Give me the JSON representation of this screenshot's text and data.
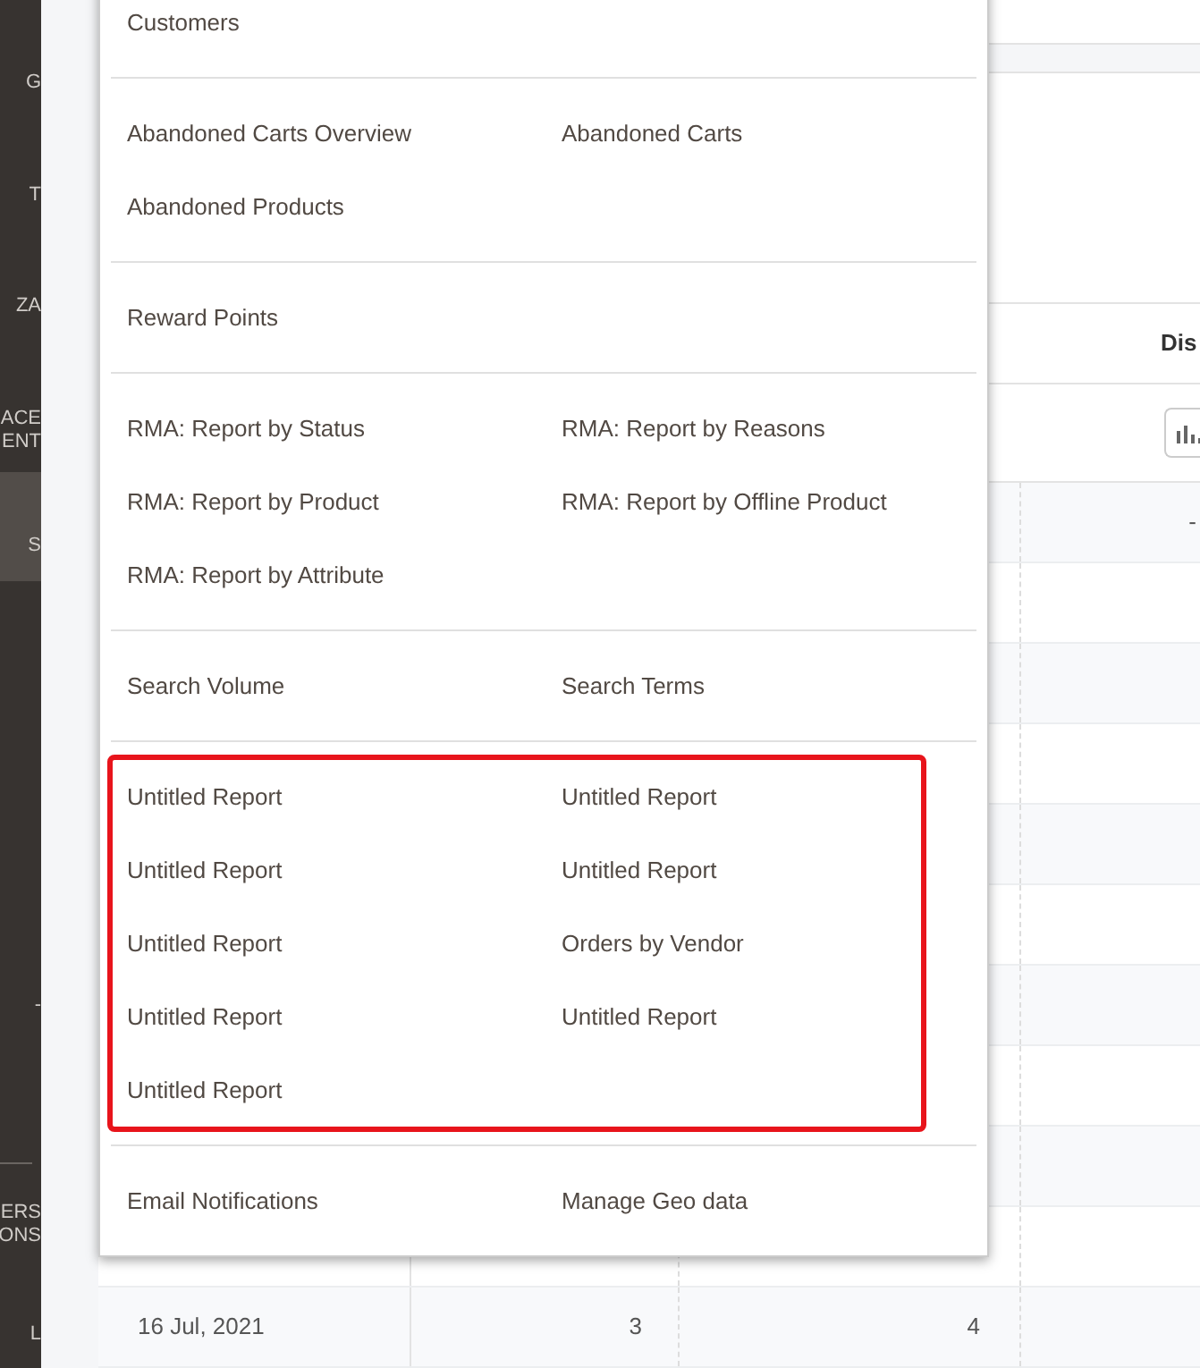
{
  "sidebar": {
    "items": [
      {
        "lines": [
          "G"
        ],
        "selected": false
      },
      {
        "lines": [
          "T"
        ],
        "selected": false
      },
      {
        "lines": [
          "ZA"
        ],
        "selected": false
      },
      {
        "lines": [
          "ACE",
          "ENT"
        ],
        "selected": false
      },
      {
        "lines": [
          "S"
        ],
        "selected": true
      },
      {
        "lines": [
          "-"
        ],
        "selected": false
      },
      {
        "lines": [
          "ERS",
          "ONS"
        ],
        "selected": false
      },
      {
        "lines": [
          "L"
        ],
        "selected": false
      }
    ]
  },
  "table": {
    "header": "Dis",
    "rows": [
      {
        "cells": [
          "",
          "",
          "",
          "-"
        ]
      },
      {
        "cells": [
          "",
          "",
          "",
          ""
        ]
      },
      {
        "cells": [
          "",
          "",
          "",
          ""
        ]
      },
      {
        "cells": [
          "",
          "",
          "",
          ""
        ]
      },
      {
        "cells": [
          "",
          "",
          "",
          ""
        ]
      },
      {
        "cells": [
          "",
          "",
          "",
          ""
        ]
      },
      {
        "cells": [
          "",
          "",
          "",
          ""
        ]
      },
      {
        "cells": [
          "",
          "",
          "",
          ""
        ]
      },
      {
        "cells": [
          "",
          "",
          "",
          ""
        ]
      },
      {
        "cells": [
          "",
          "",
          "",
          ""
        ]
      },
      {
        "cells": [
          "16 Jul, 2021",
          "3",
          "4",
          ""
        ]
      }
    ]
  },
  "reports_menu": {
    "sections": [
      {
        "highlighted": false,
        "items": [
          "Customers"
        ]
      },
      {
        "highlighted": false,
        "items": [
          "Abandoned Carts Overview",
          "Abandoned Carts",
          "Abandoned Products"
        ]
      },
      {
        "highlighted": false,
        "items": [
          "Reward Points"
        ]
      },
      {
        "highlighted": false,
        "items": [
          "RMA: Report by Status",
          "RMA: Report by Reasons",
          "RMA: Report by Product",
          "RMA: Report by Offline Product",
          "RMA: Report by Attribute"
        ]
      },
      {
        "highlighted": false,
        "items": [
          "Search Volume",
          "Search Terms"
        ]
      },
      {
        "highlighted": true,
        "items": [
          "Untitled Report",
          "Untitled Report",
          "Untitled Report",
          "Untitled Report",
          "Untitled Report",
          "Orders by Vendor",
          "Untitled Report",
          "Untitled Report",
          "Untitled Report"
        ]
      },
      {
        "highlighted": false,
        "items": [
          "Email Notifications",
          "Manage Geo data"
        ]
      }
    ]
  }
}
